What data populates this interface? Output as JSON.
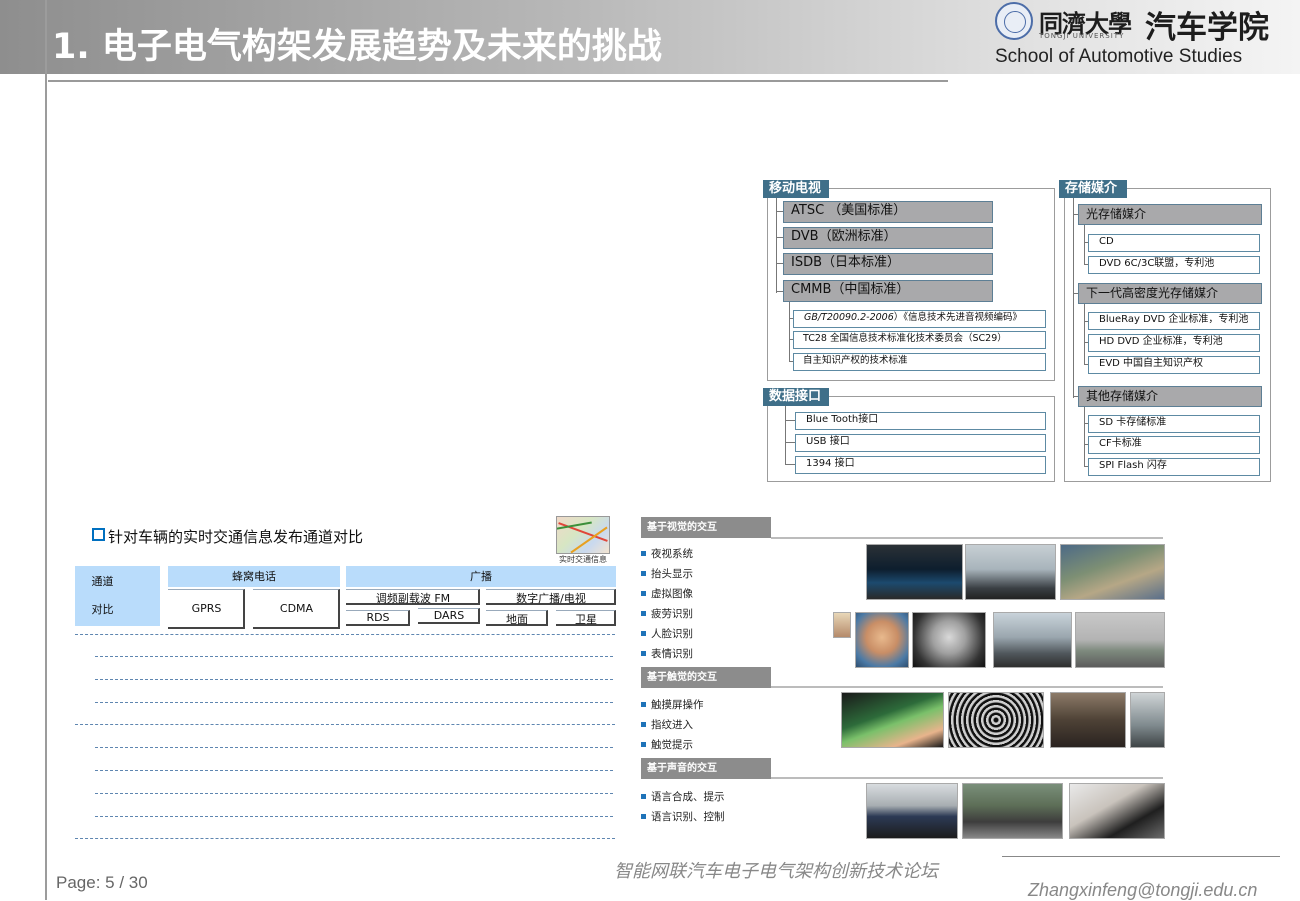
{
  "header": {
    "title": "1.  电子电气构架发展趋势及未来的挑战",
    "university_cn": "同濟大學",
    "university_en": "TONGJI UNIVERSITY",
    "school_cn": "汽车学院",
    "school_en": "School of Automotive Studies"
  },
  "diagram": {
    "mobile_tv": {
      "title": "移动电视",
      "standards": [
        "ATSC  （美国标准）",
        "DVB（欧洲标准）",
        "ISDB（日本标准）",
        "CMMB（中国标准）"
      ],
      "cmmb_children": [
        {
          "italic": "GB/T20090.2-2006",
          "rest": "）《信息技术先进音视频编码》"
        },
        {
          "italic": "",
          "rest": "TC28 全国信息技术标准化技术委员会（SC29）"
        },
        {
          "italic": "",
          "rest": "自主知识产权的技术标准"
        }
      ]
    },
    "data_interface": {
      "title": "数据接口",
      "items": [
        "Blue Tooth接口",
        "USB 接口",
        "1394 接口"
      ]
    },
    "storage": {
      "title": "存储媒介",
      "groups": [
        {
          "label": "光存储媒介",
          "items": [
            "CD",
            "DVD 6C/3C联盟，专利池"
          ]
        },
        {
          "label": "下一代高密度光存储媒介",
          "items": [
            "BlueRay DVD 企业标准，专利池",
            "HD DVD 企业标准，专利池",
            "EVD 中国自主知识产权"
          ]
        },
        {
          "label": "其他存储媒介",
          "items": [
            "SD 卡存储标准",
            "CF卡标准",
            "SPI Flash 闪存"
          ]
        }
      ]
    }
  },
  "table": {
    "heading": "针对车辆的实时交通信息发布通道对比",
    "map_caption": "实时交通信息",
    "row_header_1": "通道",
    "row_header_2": "对比",
    "group_cellular": "蜂窝电话",
    "group_broadcast": "广播",
    "col_gprs": "GPRS",
    "col_cdma": "CDMA",
    "sub_fm": "调频副载波 FM",
    "sub_digital": "数字广播/电视",
    "col_rds": "RDS",
    "col_dars": "DARS",
    "col_ground": "地面",
    "col_satellite": "卫星"
  },
  "interaction": {
    "visual": {
      "title": "基于视觉的交互",
      "items": [
        "夜视系统",
        "抬头显示",
        "虚拟图像",
        "疲劳识别",
        "人脸识别",
        "表情识别"
      ]
    },
    "touch": {
      "title": "基于触觉的交互",
      "items": [
        "触摸屏操作",
        "指纹进入",
        "触觉提示"
      ]
    },
    "voice": {
      "title": "基于声音的交互",
      "items": [
        "语言合成、提示",
        "语言识别、控制"
      ]
    }
  },
  "footer": {
    "page": "Page: 5 / 30",
    "forum": "智能网联汽车电子电气架构创新技术论坛",
    "email": "Zhangxinfeng@tongji.edu.cn"
  }
}
